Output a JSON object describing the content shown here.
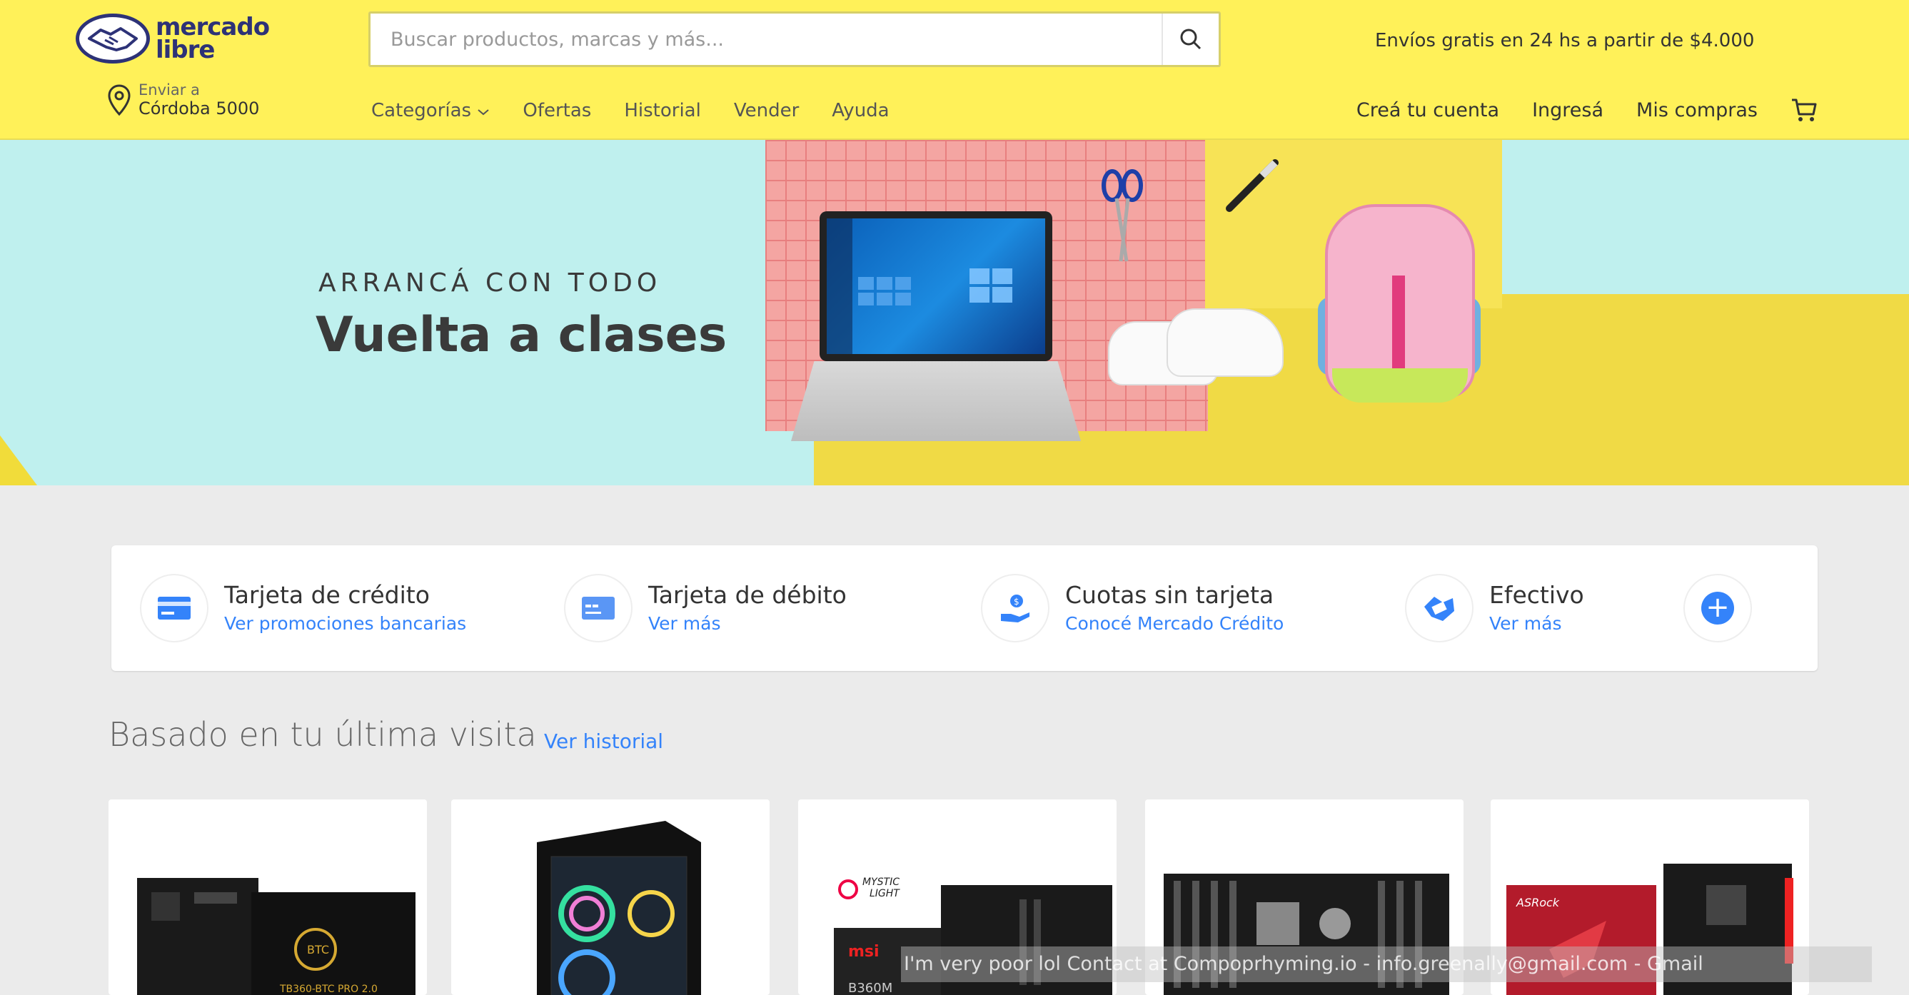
{
  "header": {
    "logo_text_line1": "mercado",
    "logo_text_line2": "libre",
    "search_placeholder": "Buscar productos, marcas y más...",
    "promo": "Envíos gratis en 24 hs a partir de $4.000",
    "location_small": "Enviar a",
    "location_main": "Córdoba 5000",
    "nav": [
      "Categorías",
      "Ofertas",
      "Historial",
      "Vender",
      "Ayuda"
    ],
    "user_nav": [
      "Creá tu cuenta",
      "Ingresá",
      "Mis compras"
    ]
  },
  "hero": {
    "kicker": "ARRANCÁ CON TODO",
    "title": "Vuelta a clases"
  },
  "payments": [
    {
      "title": "Tarjeta de crédito",
      "link": "Ver promociones bancarias",
      "icon": "credit-card-icon"
    },
    {
      "title": "Tarjeta de débito",
      "link": "Ver más",
      "icon": "debit-card-icon"
    },
    {
      "title": "Cuotas sin tarjeta",
      "link": "Conocé Mercado Crédito",
      "icon": "hand-coin-icon"
    },
    {
      "title": "Efectivo",
      "link": "Ver más",
      "icon": "cash-handshake-icon"
    }
  ],
  "recent": {
    "title": "Basado en tu última visita",
    "link": "Ver historial"
  },
  "overlay_note": "I'm very poor lol Contact at Compoprhyming.io - info.greenally@gmail.com - Gmail",
  "colors": {
    "header_bg": "#fff159",
    "link_blue": "#3483fa",
    "page_bg": "#ebebeb"
  }
}
